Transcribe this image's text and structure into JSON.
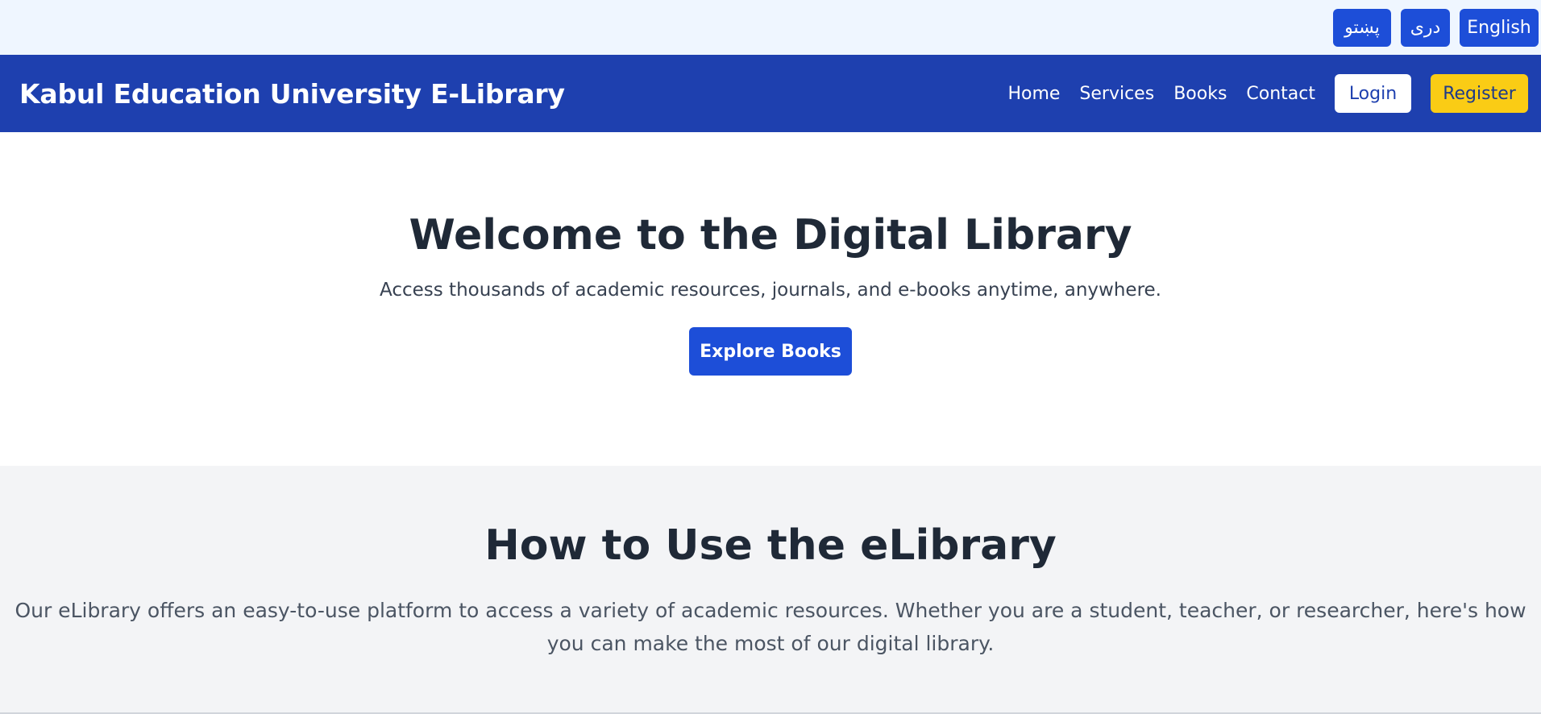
{
  "languages": {
    "pashto": "پښتو",
    "dari": "دری",
    "english": "English"
  },
  "navbar": {
    "brand": "Kabul Education University E-Library",
    "links": {
      "home": "Home",
      "services": "Services",
      "books": "Books",
      "contact": "Contact"
    },
    "login_label": "Login",
    "register_label": "Register"
  },
  "hero": {
    "title": "Welcome to the Digital Library",
    "subtitle": "Access thousands of academic resources, journals, and e-books anytime, anywhere.",
    "cta_label": "Explore Books"
  },
  "howto": {
    "title": "How to Use the eLibrary",
    "description": "Our eLibrary offers an easy-to-use platform to access a variety of academic resources. Whether you are a student, teacher, or researcher, here's how you can make the most of our digital library."
  },
  "colors": {
    "navbar_bg": "#1e40af",
    "primary_button": "#1d4ed8",
    "register_button": "#facc15",
    "lang_bar_bg": "#eff6ff",
    "section_bg": "#f3f4f6",
    "heading_text": "#1f2937"
  }
}
